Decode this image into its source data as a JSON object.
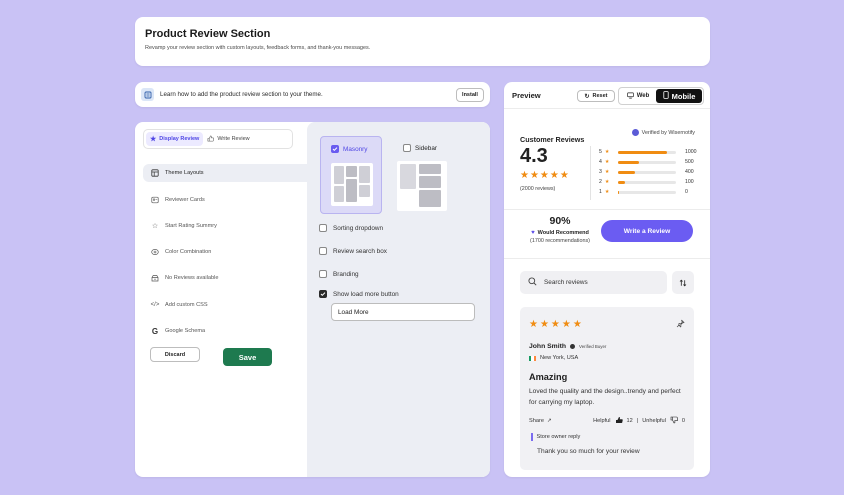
{
  "header": {
    "title": "Product Review Section",
    "subtitle": "Revamp your review section with custom layouts, feedback forms, and thank-you messages."
  },
  "info": {
    "text": "Learn how to add the product review section to your theme.",
    "install_label": "Install"
  },
  "settings": {
    "tabs": [
      {
        "label": "Display Review",
        "icon": "star-icon",
        "active": true
      },
      {
        "label": "Write Review",
        "icon": "thumbs-up-icon",
        "active": false
      }
    ],
    "menu": [
      {
        "label": "Theme Layouts",
        "icon": "layout-icon",
        "active": true
      },
      {
        "label": "Reviewer Cards",
        "icon": "card-icon",
        "active": false
      },
      {
        "label": "Start Rating Summry",
        "icon": "star-outline-icon",
        "active": false
      },
      {
        "label": "Color Combination",
        "icon": "palette-icon",
        "active": false
      },
      {
        "label": "No Reviews available",
        "icon": "empty-box-icon",
        "active": false
      },
      {
        "label": "Add custom CSS",
        "icon": "code-icon",
        "active": false
      },
      {
        "label": "Google Schema",
        "icon": "google-icon",
        "active": false
      }
    ],
    "discard_label": "Discard",
    "save_label": "Save",
    "layouts": {
      "masonry_label": "Masonry",
      "masonry_checked": true,
      "sidebar_label": "Sidebar",
      "sidebar_checked": false
    },
    "options": [
      {
        "label": "Sorting dropdown",
        "checked": false
      },
      {
        "label": "Review search box",
        "checked": false
      },
      {
        "label": "Branding",
        "checked": false
      },
      {
        "label": "Show load more button",
        "checked": true
      }
    ],
    "load_more_value": "Load More"
  },
  "preview": {
    "title": "Preview",
    "reset_label": "Reset",
    "web_label": "Web",
    "mobile_label": "Mobile",
    "customer_reviews": "Customer Reviews",
    "verified_by": "Verified by Wisernotify",
    "average": "4.3",
    "stars": "★★★★★",
    "total_reviews": "(2000 reviews)",
    "distribution": [
      {
        "star": "5",
        "count": "1000",
        "fraction": 0.84
      },
      {
        "star": "4",
        "count": "500",
        "fraction": 0.36
      },
      {
        "star": "3",
        "count": "400",
        "fraction": 0.3
      },
      {
        "star": "2",
        "count": "100",
        "fraction": 0.12
      },
      {
        "star": "1",
        "count": "0",
        "fraction": 0.02
      }
    ],
    "recommend_percent": "90%",
    "would_recommend": "Would Recommend",
    "recommendations": "(1700 recommendations)",
    "write_review_label": "Write a Review",
    "search_placeholder": "Search reviews",
    "review": {
      "stars": "★★★★★",
      "author": "John Smith",
      "verified": "Verified Buyer",
      "location": "New York, USA",
      "heading": "Amazing",
      "body": "Loved the quality and the design..trendy and perfect for carrying my laptop.",
      "share": "Share",
      "helpful": "Helpful",
      "helpful_count": "12",
      "separator": "|",
      "unhelpful": "Unhelpful",
      "unhelpful_count": "0",
      "owner_reply_label": "Store owner reply",
      "owner_reply": "Thank you so much for your review"
    }
  },
  "colors": {
    "background": "#c9c2f5",
    "accent": "#6b5cf2",
    "save": "#1e7a4f",
    "star": "#f08c12"
  }
}
